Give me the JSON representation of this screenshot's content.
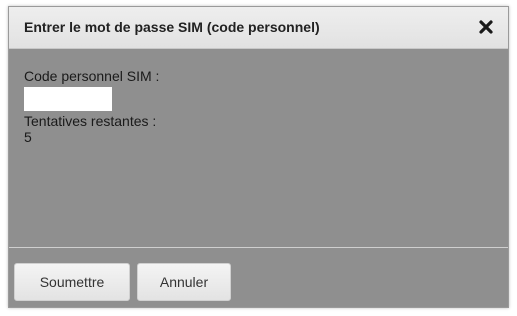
{
  "dialog": {
    "title": "Entrer le mot de passe SIM (code personnel)",
    "close_icon": "close-icon",
    "pin_label": "Code personnel SIM :",
    "pin_value": "",
    "attempts_label": "Tentatives restantes :",
    "attempts_value": "5",
    "submit_label": "Soumettre",
    "cancel_label": "Annuler"
  },
  "colors": {
    "title_bar": "#e8e8e8",
    "body_background": "#8f8f8f",
    "input_background": "#ffffff",
    "button_background": "#eeeeee"
  }
}
